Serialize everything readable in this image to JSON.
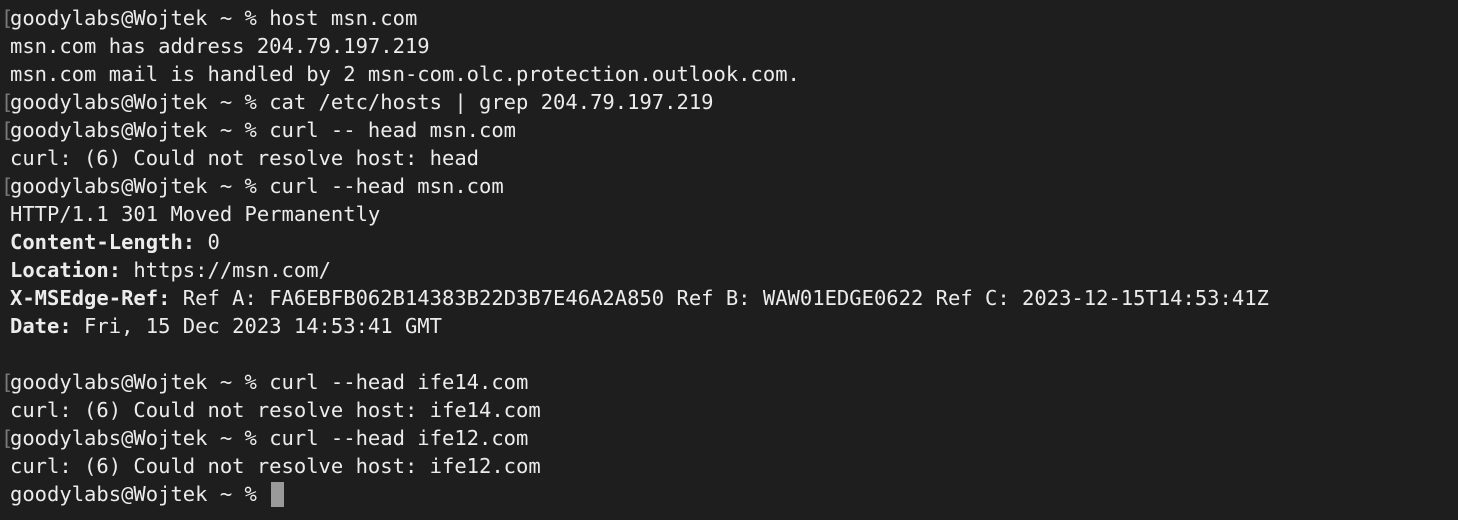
{
  "terminal": {
    "lines": [
      {
        "type": "prompt",
        "prompt": "goodylabs@Wojtek ~ %",
        "command": "host msn.com"
      },
      {
        "type": "output",
        "text": "msn.com has address 204.79.197.219"
      },
      {
        "type": "output",
        "text": "msn.com mail is handled by 2 msn-com.olc.protection.outlook.com."
      },
      {
        "type": "prompt",
        "prompt": "goodylabs@Wojtek ~ %",
        "command": "cat /etc/hosts | grep 204.79.197.219"
      },
      {
        "type": "prompt",
        "prompt": "goodylabs@Wojtek ~ %",
        "command": "curl -- head msn.com"
      },
      {
        "type": "output",
        "text": "curl: (6) Could not resolve host: head"
      },
      {
        "type": "prompt",
        "prompt": "goodylabs@Wojtek ~ %",
        "command": "curl --head msn.com"
      },
      {
        "type": "output",
        "text": "HTTP/1.1 301 Moved Permanently"
      },
      {
        "type": "header",
        "key": "Content-Length:",
        "value": " 0"
      },
      {
        "type": "header",
        "key": "Location:",
        "value": " https://msn.com/"
      },
      {
        "type": "header",
        "key": "X-MSEdge-Ref:",
        "value": " Ref A: FA6EBFB062B14383B22D3B7E46A2A850 Ref B: WAW01EDGE0622 Ref C: 2023-12-15T14:53:41Z"
      },
      {
        "type": "header",
        "key": "Date:",
        "value": " Fri, 15 Dec 2023 14:53:41 GMT"
      },
      {
        "type": "blank"
      },
      {
        "type": "prompt",
        "prompt": "goodylabs@Wojtek ~ %",
        "command": "curl --head ife14.com"
      },
      {
        "type": "output",
        "text": "curl: (6) Could not resolve host: ife14.com"
      },
      {
        "type": "prompt",
        "prompt": "goodylabs@Wojtek ~ %",
        "command": "curl --head ife12.com"
      },
      {
        "type": "output",
        "text": "curl: (6) Could not resolve host: ife12.com"
      }
    ],
    "current_prompt": "goodylabs@Wojtek ~ %",
    "colors": {
      "background": "#1e1e1e",
      "text": "#ececec",
      "cursor": "#9a9a9a"
    }
  }
}
